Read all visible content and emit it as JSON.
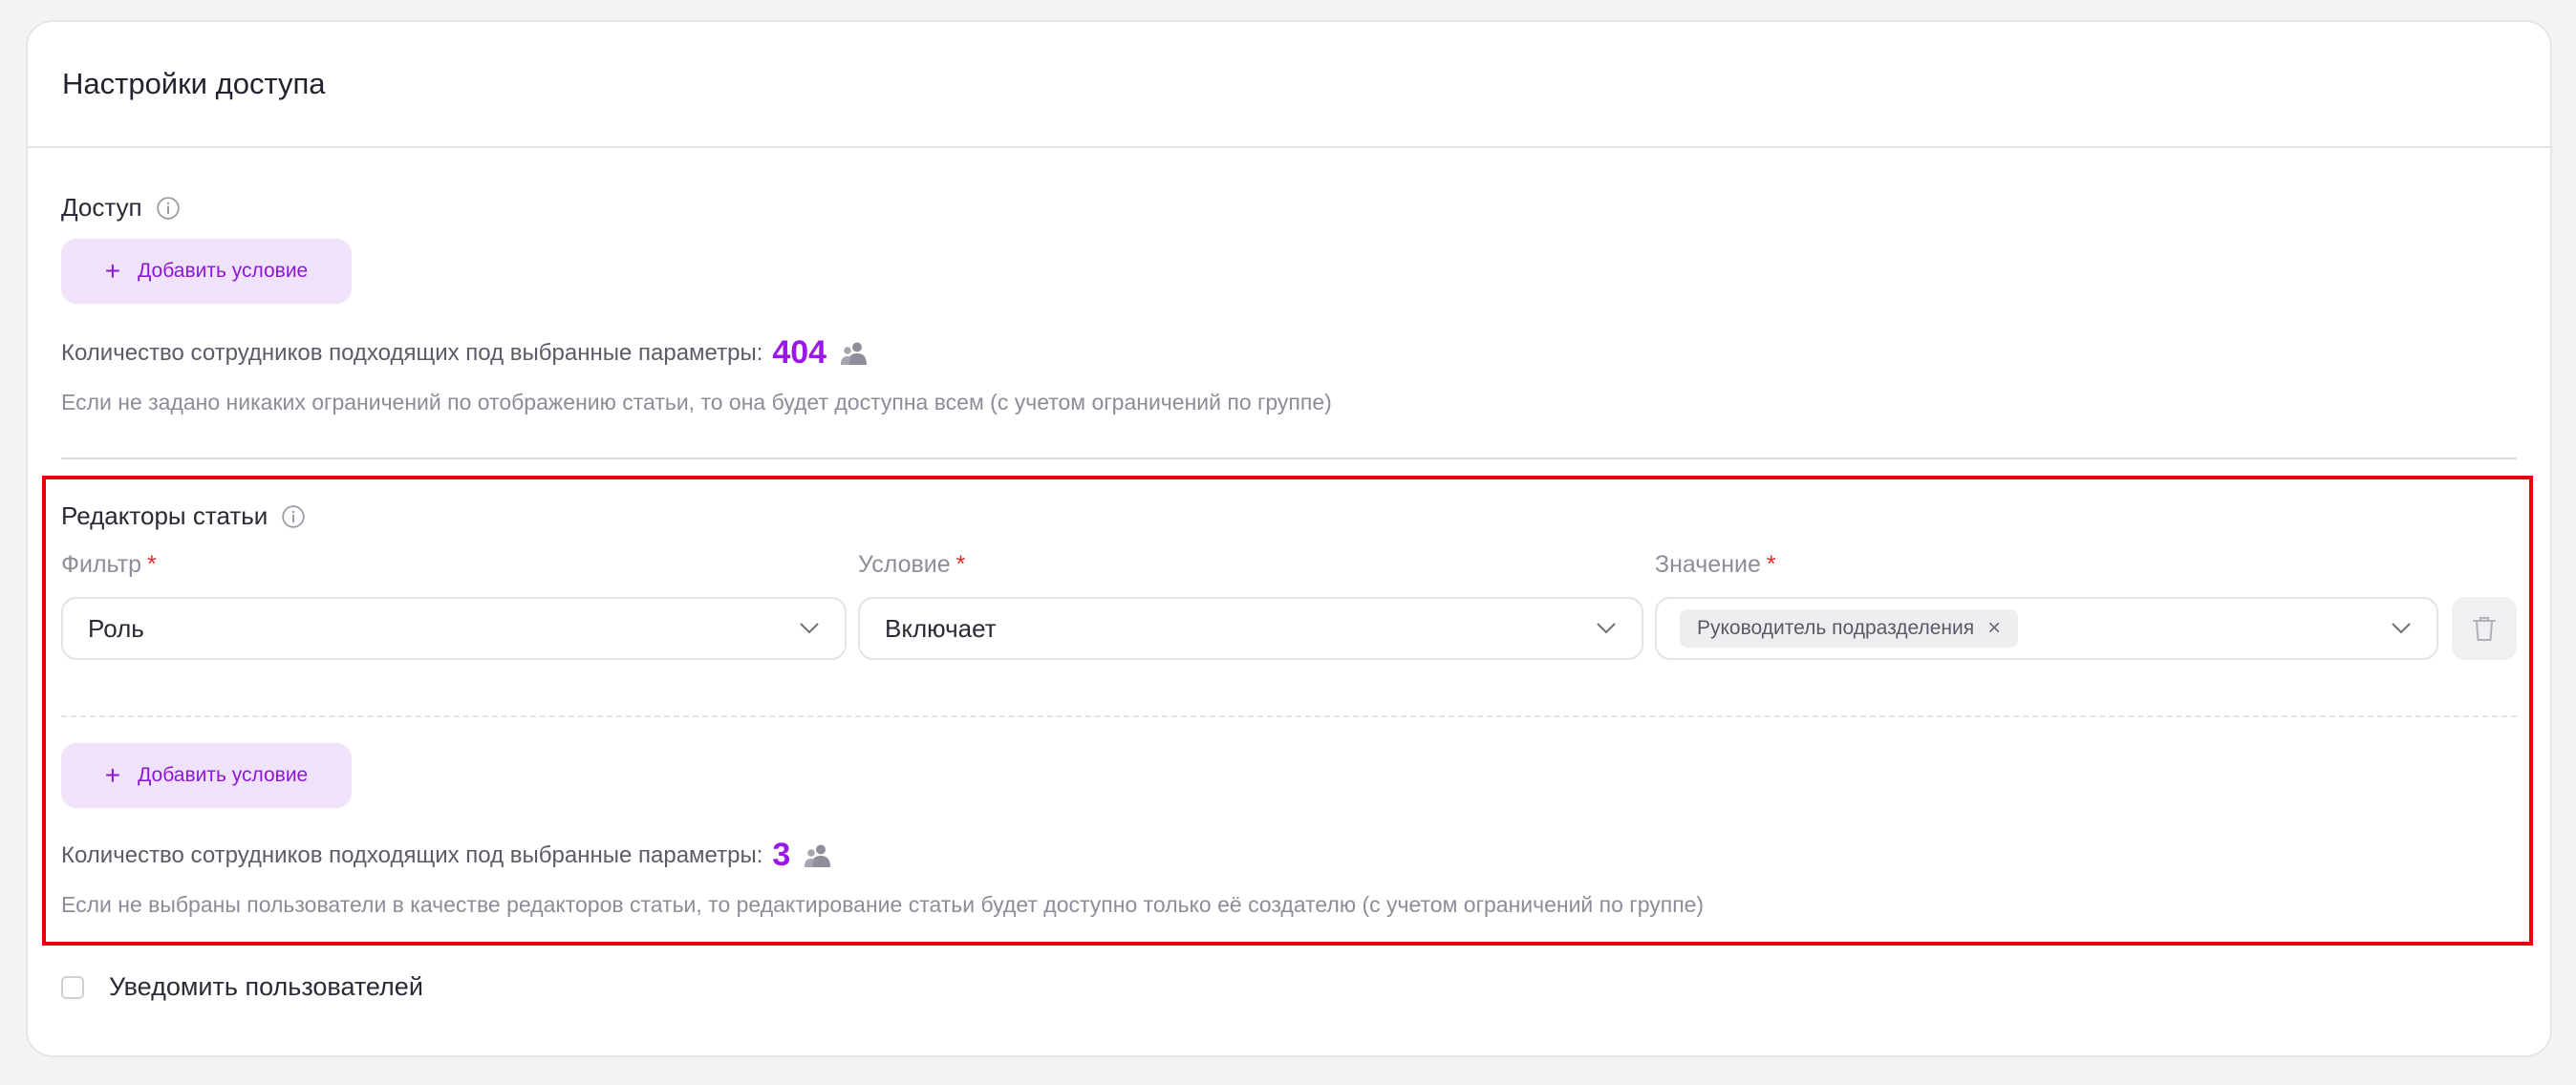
{
  "card": {
    "title": "Настройки доступа"
  },
  "access": {
    "label": "Доступ",
    "add_button": {
      "plus": "+",
      "label": "Добавить условие"
    },
    "count_text": "Количество сотрудников подходящих под выбранные параметры:",
    "count_value": "404",
    "hint": "Если не задано никаких ограничений по отображению статьи, то она будет доступна всем (с учетом ограничений по группе)"
  },
  "editors": {
    "label": "Редакторы статьи",
    "columns": {
      "filter": {
        "label": "Фильтр",
        "required": "*"
      },
      "condition": {
        "label": "Условие",
        "required": "*"
      },
      "value": {
        "label": "Значение",
        "required": "*"
      }
    },
    "row": {
      "filter": "Роль",
      "condition": "Включает",
      "value_chip": "Руководитель подразделения",
      "chip_remove": "×"
    },
    "add_button": {
      "plus": "+",
      "label": "Добавить условие"
    },
    "count_text": "Количество сотрудников подходящих под выбранные параметры:",
    "count_value": "3",
    "hint": "Если не выбраны пользователи в качестве редакторов статьи, то редактирование статьи будет доступно только её создателю (с учетом ограничений по группе)"
  },
  "notify": {
    "label": "Уведомить пользователей",
    "checked": false
  },
  "colors": {
    "accent": "#9b17e8",
    "button_bg": "#f1e2fb",
    "highlight": "#e6000f",
    "required": "#e52929"
  },
  "icons": [
    "info-icon",
    "plus-icon",
    "people-icon",
    "chevron-down-icon",
    "close-icon",
    "trash-icon"
  ]
}
